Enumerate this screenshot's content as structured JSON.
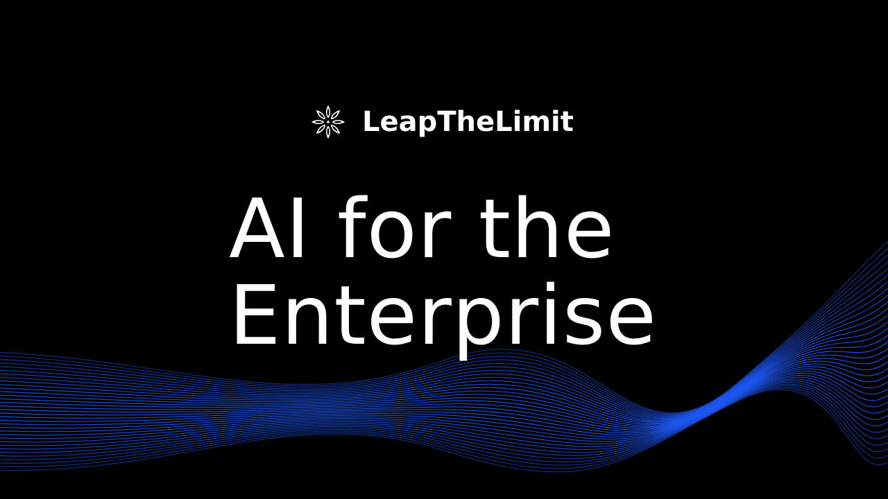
{
  "brand": {
    "name": "LeapTheLimit",
    "icon": "star-flower-icon"
  },
  "headline": {
    "line1": "AI for the",
    "line2": "Enterprise"
  },
  "colors": {
    "background": "#000000",
    "text": "#ffffff",
    "accent": "#1f5bff"
  }
}
